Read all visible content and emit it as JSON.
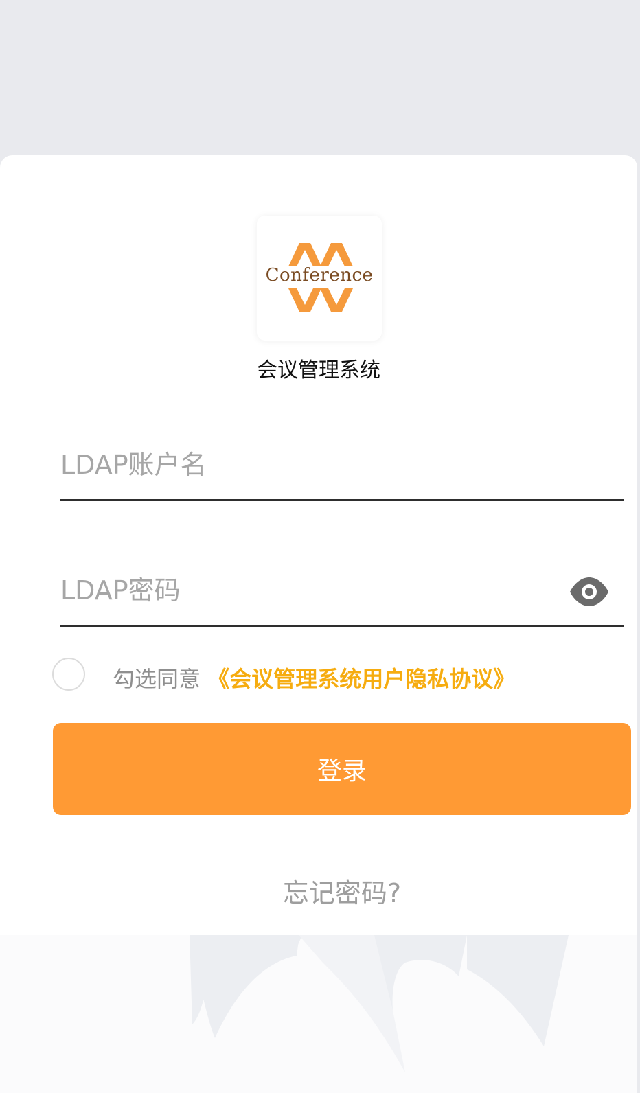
{
  "app": {
    "logo_text": "Conference",
    "title": "会议管理系统"
  },
  "form": {
    "username_placeholder": "LDAP账户名",
    "username_value": "",
    "password_placeholder": "LDAP密码",
    "password_value": ""
  },
  "agreement": {
    "prefix": "勾选同意",
    "link_label": "《会议管理系统用户隐私协议》",
    "checked": false
  },
  "actions": {
    "login_label": "登录",
    "forgot_label": "忘记密码?"
  },
  "icons": {
    "password_toggle": "eye-icon",
    "agreement_checkbox": "radio-circle-icon"
  },
  "colors": {
    "accent": "#ff9a34",
    "link": "#f6ac10",
    "background": "#e9eaee",
    "placeholder": "#a6a6a6"
  }
}
